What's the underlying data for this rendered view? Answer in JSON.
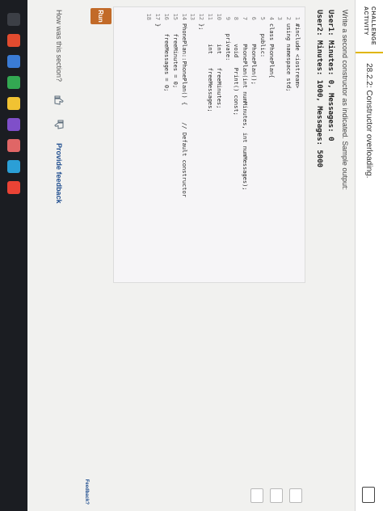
{
  "activity": {
    "tag_line1": "CHALLENGE",
    "tag_line2": "ACTIVITY",
    "title": "28.2.2: Constructor overloading."
  },
  "instructions": "Write a second constructor as indicated. Sample output:",
  "sample_output": [
    "User1: Minutes: 0, Messages: 0",
    "User2: Minutes: 1000, Messages: 5000"
  ],
  "code": [
    {
      "n": "1",
      "text": "#include <iostream>"
    },
    {
      "n": "2",
      "text": "using namespace std;"
    },
    {
      "n": "3",
      "text": ""
    },
    {
      "n": "4",
      "text": "class PhonePlan{"
    },
    {
      "n": "5",
      "text": "   public:"
    },
    {
      "n": "6",
      "text": "      PhonePlan();"
    },
    {
      "n": "7",
      "text": "      PhonePlan(int numMinutes, int numMessages);"
    },
    {
      "n": "8",
      "text": "      void   Print() const;"
    },
    {
      "n": "9",
      "text": "   private:"
    },
    {
      "n": "10",
      "text": "      int    freeMinutes;"
    },
    {
      "n": "11",
      "text": "      int    freeMessages;"
    },
    {
      "n": "12",
      "text": "};"
    },
    {
      "n": "13",
      "text": ""
    },
    {
      "n": "14",
      "text": "PhonePlan::PhonePlan() {     // Default constructor"
    },
    {
      "n": "15",
      "text": "   freeMinutes = 0;"
    },
    {
      "n": "16",
      "text": "   freeMessages = 0;"
    },
    {
      "n": "17",
      "text": "}"
    },
    {
      "n": "18",
      "text": ""
    }
  ],
  "run_label": "Run",
  "feedback": {
    "question": "How was this section?",
    "provide_label": "Provide feedback",
    "small_label": "Feedback?"
  },
  "colors": {
    "run_button": "#c26a28",
    "accent": "#1d4c8e",
    "activity_border": "#e0b600"
  },
  "icons": [
    "thumbs-up-icon",
    "thumbs-down-icon",
    "feedback-icon"
  ]
}
